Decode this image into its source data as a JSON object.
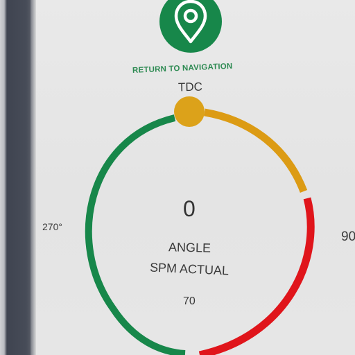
{
  "navigation": {
    "return_label": "RETURN TO NAVIGATION",
    "icon": "location-pin-icon"
  },
  "dial": {
    "top_label": "TDC",
    "left_label": "270°",
    "right_label": "90",
    "angle_value": "0",
    "angle_label": "ANGLE",
    "spm_label": "SPM ACTUAL",
    "spm_value": "70"
  },
  "colors": {
    "accent_green": "#17874a",
    "amber": "#dc9b14",
    "red": "#e0151b",
    "text": "#333333"
  }
}
